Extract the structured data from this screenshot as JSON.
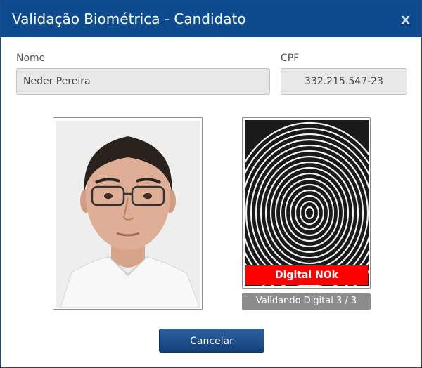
{
  "dialog": {
    "title": "Validação Biométrica - Candidato",
    "close_label": "x"
  },
  "form": {
    "name_label": "Nome",
    "name_value": "Neder Pereira",
    "cpf_label": "CPF",
    "cpf_value": "332.215.547-23"
  },
  "fingerprint": {
    "status_text": "Digital NOk",
    "status_color": "#ff0000",
    "progress_text": "Validando Digital 3 / 3"
  },
  "actions": {
    "cancel_label": "Cancelar"
  },
  "colors": {
    "titlebar": "#0d4a8e",
    "button": "#1b4f8f",
    "pill": "#8c8c8c"
  }
}
